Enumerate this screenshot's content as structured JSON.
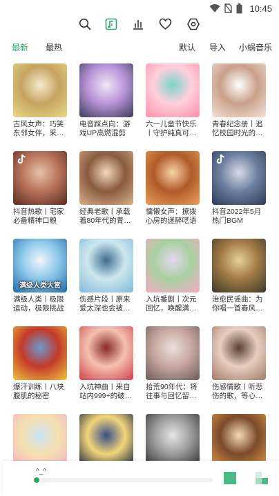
{
  "status_bar": {
    "time": "10:45"
  },
  "toolbar": {
    "icons": [
      "search-icon",
      "music-library-icon",
      "chart-icon",
      "heart-icon",
      "settings-icon"
    ],
    "accent": "#27a86b"
  },
  "tabs": {
    "latest": "最新",
    "hottest": "最热",
    "default": "默认",
    "import": "导入",
    "source": "小蜗音乐"
  },
  "playlists": [
    {
      "title": "古风女声：巧笑东邻女伴，采…",
      "colors": [
        "#e9d98a",
        "#c6a35f",
        "#f6ead0"
      ]
    },
    {
      "title": "电音踩点向：游戏UP高燃混剪",
      "colors": [
        "#3b3b5c",
        "#b995d8",
        "#f1e6f6"
      ]
    },
    {
      "title": "六一儿童节快乐丨守护纯真可…",
      "colors": [
        "#ff8fa8",
        "#ffd0dc",
        "#7ad4c8"
      ]
    },
    {
      "title": "青春纪念册丨追忆校园时光的…",
      "colors": [
        "#f4e2d8",
        "#c9a08a",
        "#ffffff"
      ]
    },
    {
      "title": "抖音热歌丨宅家必备精神口粮",
      "colors": [
        "#5a2c20",
        "#b8725a",
        "#e7c1a8"
      ],
      "tiktok": true
    },
    {
      "title": "经典老歌丨承载着80年代的青…",
      "colors": [
        "#d8b08a",
        "#8a5b3e",
        "#f3d7bd"
      ]
    },
    {
      "title": "慵懒女声：撩拨心房的迷醉呓语",
      "colors": [
        "#e9a15a",
        "#b05a2a",
        "#f7d4a4"
      ]
    },
    {
      "title": "抖音2022年5月热门BGM",
      "colors": [
        "#2b3a55",
        "#6d7fa0",
        "#d7dbe6"
      ],
      "tiktok": true
    },
    {
      "title": "满级人类丨极限运动，极限挑战",
      "colors": [
        "#1f6aa8",
        "#8cc7ea",
        "#f2f6f9"
      ],
      "caption": "满级人类大赏"
    },
    {
      "title": "伤感片段丨原来爱太深也会被…",
      "colors": [
        "#7fb9d6",
        "#cde7f0",
        "#3f6f8f"
      ]
    },
    {
      "title": "入坑番剧丨次元回忆，唤醒满…",
      "colors": [
        "#f4a9c4",
        "#a8d0a0",
        "#e5d7f2"
      ]
    },
    {
      "title": "治愈民谣曲：为你唱一首春风…",
      "colors": [
        "#3a3a2a",
        "#a27a45",
        "#e6cf9a"
      ]
    },
    {
      "title": "爆汗训练丨八块腹肌的秘密",
      "colors": [
        "#f0c43c",
        "#c43a2a",
        "#6a9ad0"
      ]
    },
    {
      "title": "入坑神曲丨来自站内999+的破…",
      "colors": [
        "#d0404a",
        "#f4c2b0",
        "#8a2a2a"
      ]
    },
    {
      "title": "拾荒90年代：将往事与回忆留…",
      "colors": [
        "#6a5a5a",
        "#c8a8a0",
        "#ece0dc"
      ]
    },
    {
      "title": "伤感情歌丨听悲伤的歌，等心…",
      "colors": [
        "#a07a6a",
        "#e8cfc0",
        "#5a4038"
      ]
    },
    {
      "title": "",
      "colors": [
        "#f2b2c8",
        "#f6e0b0",
        "#c8e2f2"
      ]
    },
    {
      "title": "",
      "colors": [
        "#0d1a3a",
        "#f2d57a",
        "#3a4f8a"
      ]
    },
    {
      "title": "",
      "colors": [
        "#2a2a2a",
        "#9a9a9a",
        "#e6e6e6"
      ]
    },
    {
      "title": "",
      "colors": [
        "#e69a4a",
        "#7a4a2a",
        "#f6d9b0"
      ]
    }
  ],
  "player": {
    "song": "^_^",
    "progress": 0,
    "accent": "#27a86b"
  }
}
